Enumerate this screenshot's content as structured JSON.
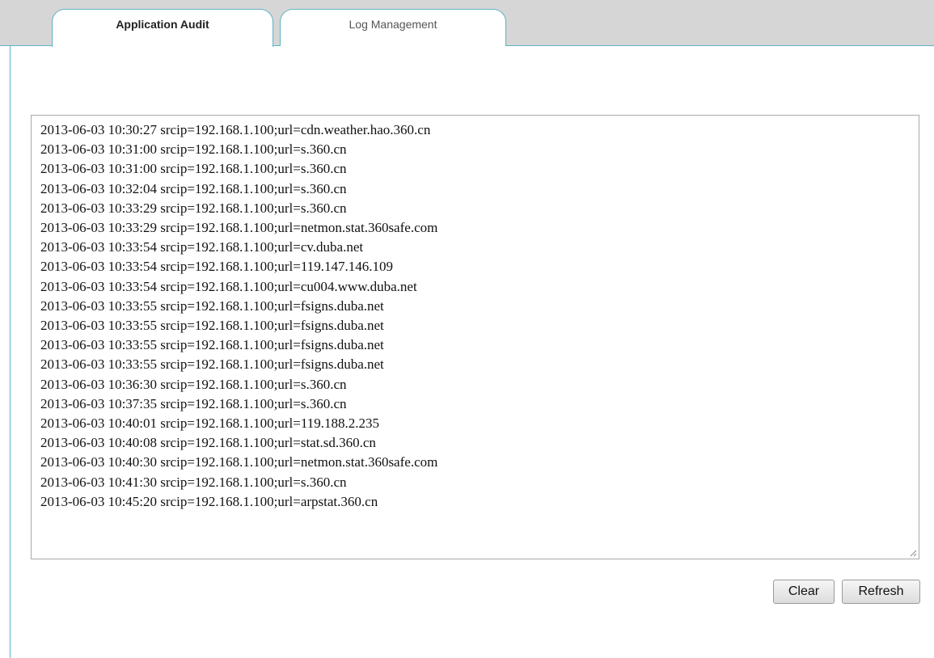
{
  "tabs": {
    "active": "Application Audit",
    "inactive": "Log Management"
  },
  "log": {
    "lines": [
      "2013-06-03 10:30:27 srcip=192.168.1.100;url=cdn.weather.hao.360.cn",
      "2013-06-03 10:31:00 srcip=192.168.1.100;url=s.360.cn",
      "2013-06-03 10:31:00 srcip=192.168.1.100;url=s.360.cn",
      "2013-06-03 10:32:04 srcip=192.168.1.100;url=s.360.cn",
      "2013-06-03 10:33:29 srcip=192.168.1.100;url=s.360.cn",
      "2013-06-03 10:33:29 srcip=192.168.1.100;url=netmon.stat.360safe.com",
      "2013-06-03 10:33:54 srcip=192.168.1.100;url=cv.duba.net",
      "2013-06-03 10:33:54 srcip=192.168.1.100;url=119.147.146.109",
      "2013-06-03 10:33:54 srcip=192.168.1.100;url=cu004.www.duba.net",
      "2013-06-03 10:33:55 srcip=192.168.1.100;url=fsigns.duba.net",
      "2013-06-03 10:33:55 srcip=192.168.1.100;url=fsigns.duba.net",
      "2013-06-03 10:33:55 srcip=192.168.1.100;url=fsigns.duba.net",
      "2013-06-03 10:33:55 srcip=192.168.1.100;url=fsigns.duba.net",
      "2013-06-03 10:36:30 srcip=192.168.1.100;url=s.360.cn",
      "2013-06-03 10:37:35 srcip=192.168.1.100;url=s.360.cn",
      "2013-06-03 10:40:01 srcip=192.168.1.100;url=119.188.2.235",
      "2013-06-03 10:40:08 srcip=192.168.1.100;url=stat.sd.360.cn",
      "2013-06-03 10:40:30 srcip=192.168.1.100;url=netmon.stat.360safe.com",
      "2013-06-03 10:41:30 srcip=192.168.1.100;url=s.360.cn",
      "2013-06-03 10:45:20 srcip=192.168.1.100;url=arpstat.360.cn"
    ]
  },
  "buttons": {
    "clear": "Clear",
    "refresh": "Refresh"
  },
  "colors": {
    "tab_border": "#5fb3c4",
    "tabbar_bg": "#d6d6d6"
  }
}
